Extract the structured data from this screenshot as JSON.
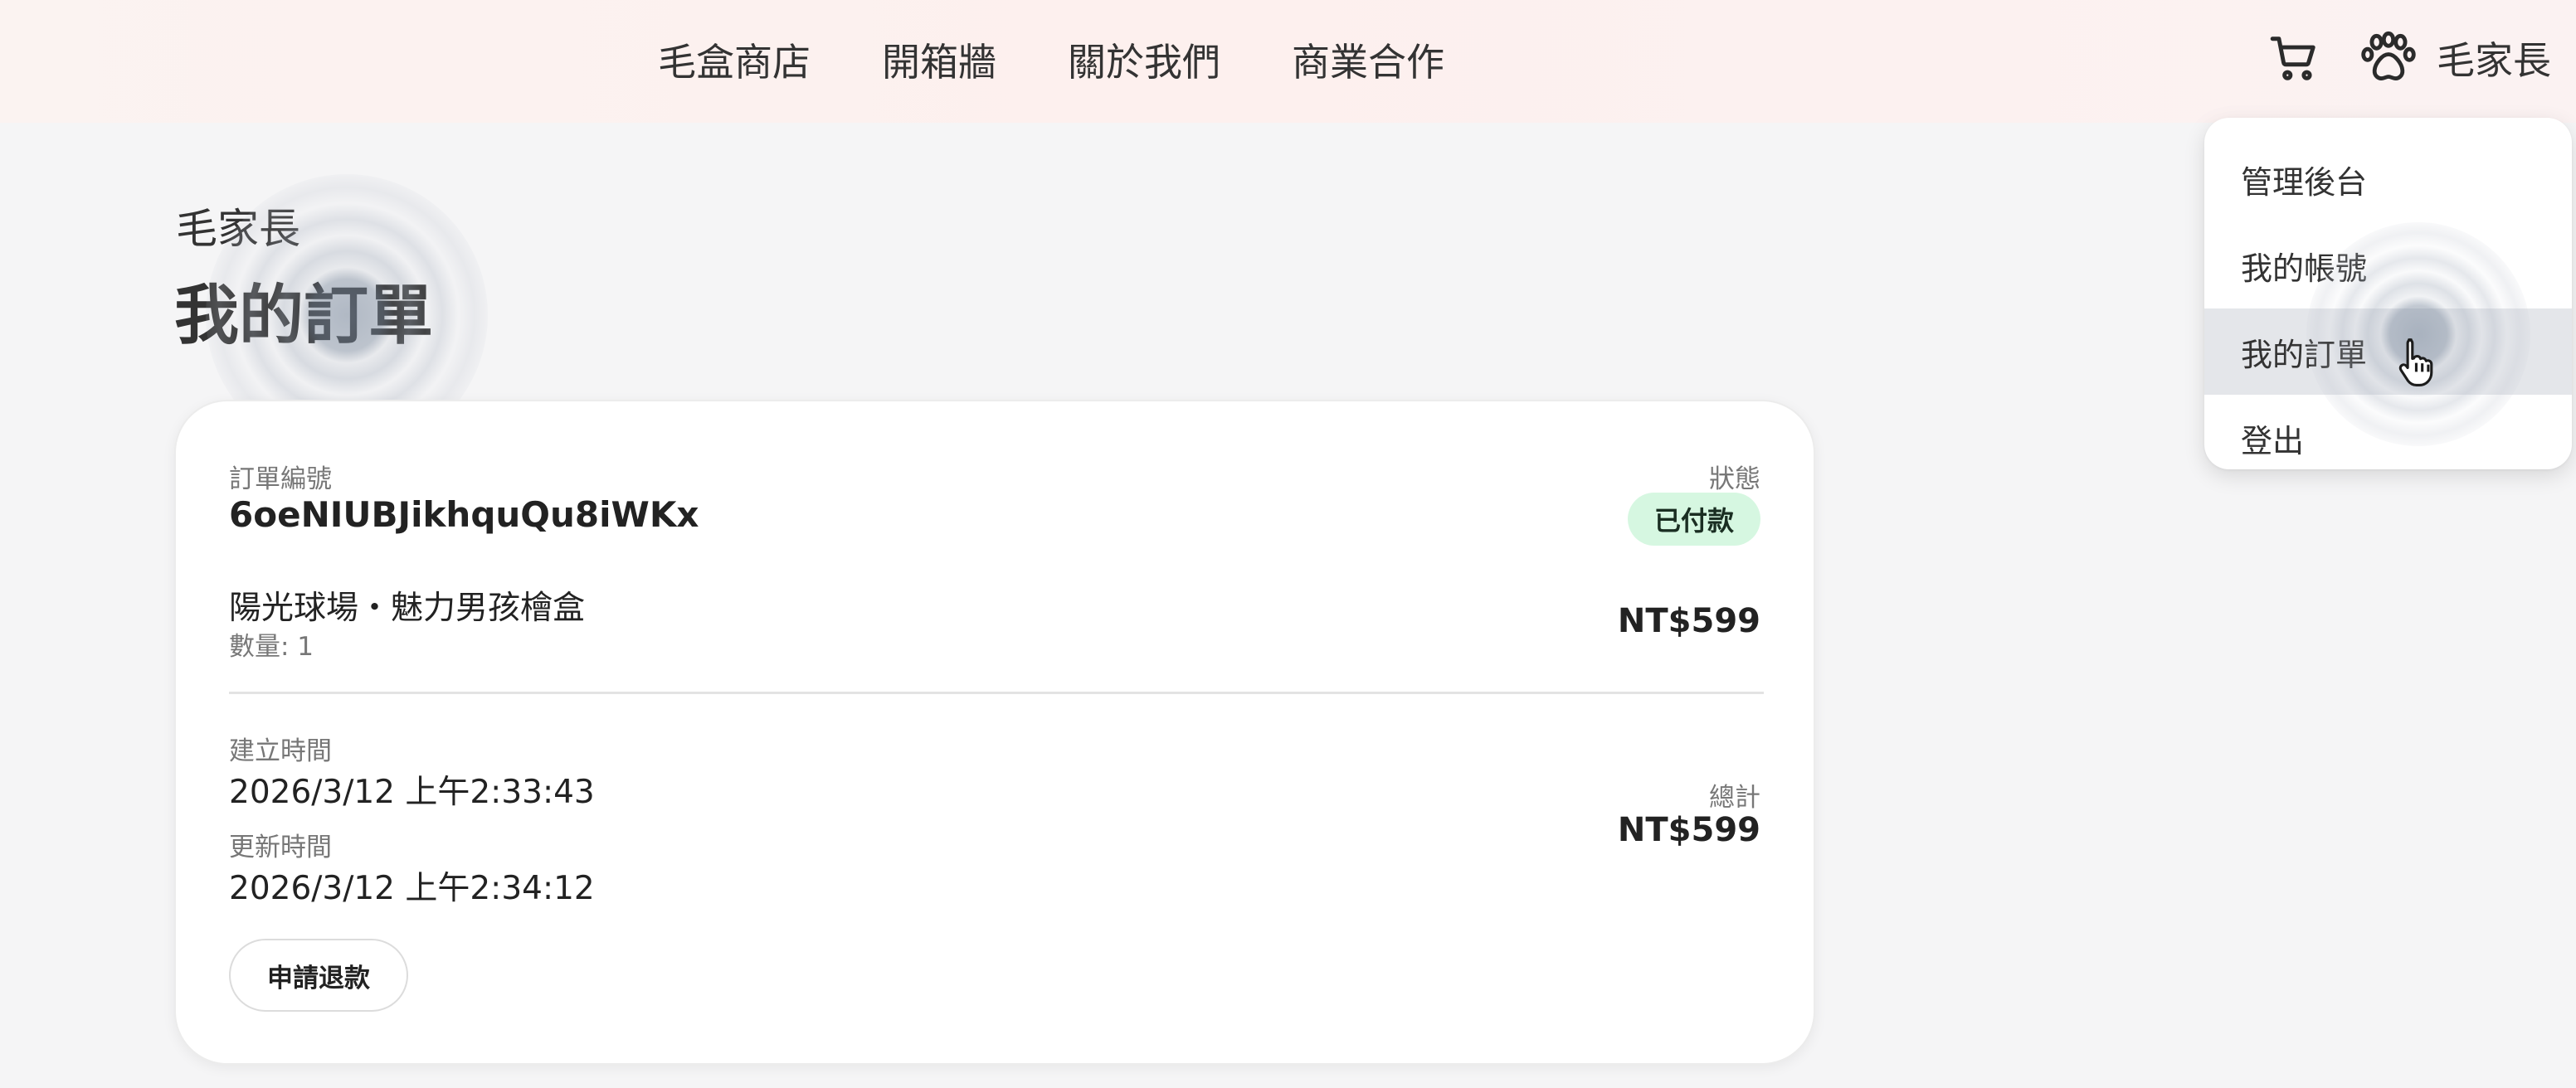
{
  "nav": {
    "items": [
      "毛盒商店",
      "開箱牆",
      "關於我們",
      "商業合作"
    ]
  },
  "header": {
    "cart_icon": "cart-icon",
    "paw_icon": "paw-icon",
    "user_name": "毛家長"
  },
  "dropdown": {
    "items": [
      "管理後台",
      "我的帳號",
      "我的訂單",
      "登出"
    ],
    "active_item": "我的訂單"
  },
  "page": {
    "subtitle": "毛家長",
    "title": "我的訂單"
  },
  "order": {
    "id_label": "訂單編號",
    "id": "6oeNIUBJikhquQu8iWKx",
    "status_label": "狀態",
    "status": "已付款",
    "product_name": "陽光球場・魅力男孩檜盒",
    "quantity": "數量: 1",
    "item_price": "NT$599",
    "created_label": "建立時間",
    "created_at": "2026/3/12 上午2:33:43",
    "updated_label": "更新時間",
    "updated_at": "2026/3/12 上午2:34:12",
    "total_label": "總計",
    "total": "NT$599",
    "refund_button": "申請退款"
  },
  "colors": {
    "header_bg": "#fdf0ee",
    "status_badge_bg": "#d6f7e1",
    "active_menu_bg": "#e4e6ea"
  }
}
